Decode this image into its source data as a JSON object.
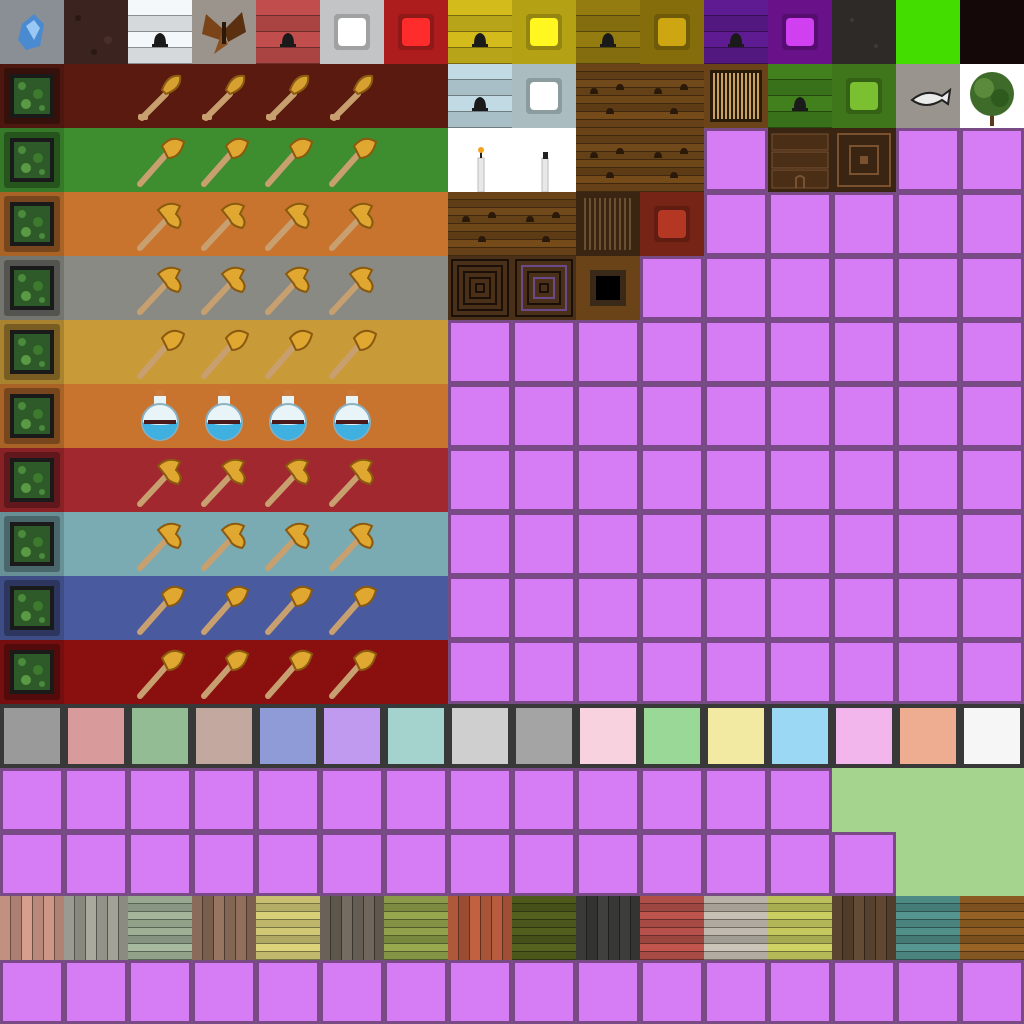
{
  "sheet": {
    "placeholder_color": "#d67cf4",
    "grid_line_color": "#7a4a86",
    "swatch_border": "#383838"
  },
  "top_row": [
    {
      "icon": "blue-gem-icon",
      "bg": "#8a8f95"
    },
    {
      "icon": "dark-dirt-icon",
      "bg": "#3b2420"
    },
    {
      "icon": "white-plank-bell-icon",
      "bg": "#e8ecef"
    },
    {
      "icon": "moth-icon",
      "bg": "#9a948c"
    },
    {
      "icon": "red-plank-bell-icon",
      "bg": "#b84a48"
    },
    {
      "icon": "white-panel-icon",
      "bg": "#e4e6e8"
    },
    {
      "icon": "red-panel-icon",
      "bg": "#cc2222"
    },
    {
      "icon": "yellow-plank-bell-icon",
      "bg": "#c8b21a"
    },
    {
      "icon": "yellow-panel-icon",
      "bg": "#d4be18"
    },
    {
      "icon": "olive-plank-bell-icon",
      "bg": "#8e7610"
    },
    {
      "icon": "olive-panel-icon",
      "bg": "#9e800e"
    },
    {
      "icon": "purple-plank-bell-icon",
      "bg": "#5a1a8a"
    },
    {
      "icon": "magenta-panel-icon",
      "bg": "#7a14a0"
    },
    {
      "icon": "dark-stone-icon",
      "bg": "#2e2a28"
    },
    {
      "icon": "green-block-icon",
      "bg": "#44dd00"
    },
    {
      "icon": "black-block-icon",
      "bg": "#140808"
    }
  ],
  "tool_rows": [
    {
      "color": "#5a1a10",
      "item": "shovel"
    },
    {
      "color": "#3e8e30",
      "item": "axe"
    },
    {
      "color": "#c8742e",
      "item": "hammer"
    },
    {
      "color": "#8a8a84",
      "item": "hammer"
    },
    {
      "color": "#c89a38",
      "item": "axe"
    },
    {
      "color": "#c8742e",
      "item": "potion"
    },
    {
      "color": "#a0282e",
      "item": "hammer"
    },
    {
      "color": "#7aaab2",
      "item": "hammer"
    },
    {
      "color": "#4a5a9e",
      "item": "axe"
    },
    {
      "color": "#8a1010",
      "item": "axe"
    }
  ],
  "furniture_tiles": [
    {
      "icon": "pale-plank-bell-icon",
      "bg": "#b8d0d8"
    },
    {
      "icon": "pale-panel-icon",
      "bg": "#c8dde2"
    },
    {
      "icon": "wood-knobs-icon",
      "bg": "#6a4418"
    },
    {
      "icon": "wood-knobs-icon",
      "bg": "#6a4418"
    },
    {
      "icon": "striped-panel-icon",
      "bg": "#8a6a38"
    },
    {
      "icon": "green-plank-bell-icon",
      "bg": "#3e7a1c"
    },
    {
      "icon": "green-panel-icon",
      "bg": "#4a8a20"
    },
    {
      "icon": "gravel-fish-icon",
      "bg": "#9a948e"
    },
    {
      "icon": "tree-icon",
      "bg": "#ffffff"
    },
    {
      "icon": "candle-lit-icon",
      "bg": "#ffffff"
    },
    {
      "icon": "candle-unlit-icon",
      "bg": "#ffffff"
    },
    {
      "icon": "wood-knobs-icon",
      "bg": "#6a4418"
    },
    {
      "icon": "wood-knobs-icon",
      "bg": "#6a4418"
    },
    {
      "icon": "dresser-icon",
      "bg": "#3a2412"
    },
    {
      "icon": "concentric-panel-icon",
      "bg": "#3a2412"
    },
    {
      "icon": "wood-knobs-icon",
      "bg": "#6a4418"
    },
    {
      "icon": "wood-knobs-icon",
      "bg": "#6a4418"
    },
    {
      "icon": "wood-knobs-icon",
      "bg": "#6a4418"
    },
    {
      "icon": "dark-grill-icon",
      "bg": "#3a2412"
    },
    {
      "icon": "red-panel-icon",
      "bg": "#8a2a1a"
    },
    {
      "icon": "concentric-square-icon",
      "bg": "#4a3018"
    },
    {
      "icon": "concentric-square-purple-icon",
      "bg": "#4a3018"
    },
    {
      "icon": "black-hole-icon",
      "bg": "#6a4418"
    }
  ],
  "swatches": [
    "#9a9a9a",
    "#d99a9c",
    "#93bb94",
    "#c2a89e",
    "#8f9bd6",
    "#c09aee",
    "#a4d2cc",
    "#cfcfcf",
    "#a4a4a4",
    "#f8d2de",
    "#9ad898",
    "#f2eaa2",
    "#9ad8f4",
    "#f2b6ec",
    "#eeac90",
    "#f6f6f6"
  ],
  "wood_textures": [
    {
      "icon": "pink-birch-plank-icon",
      "bg": "#c29080"
    },
    {
      "icon": "gray-plank-icon",
      "bg": "#9a9a90"
    },
    {
      "icon": "sage-slat-icon",
      "bg": "#98a890"
    },
    {
      "icon": "weathered-plank-icon",
      "bg": "#8a6a58"
    },
    {
      "icon": "bamboo-plank-icon",
      "bg": "#c8c070"
    },
    {
      "icon": "dark-gray-plank-icon",
      "bg": "#6a6258"
    },
    {
      "icon": "green-bamboo-icon",
      "bg": "#8a9a48"
    },
    {
      "icon": "red-cedar-plank-icon",
      "bg": "#b0583a"
    },
    {
      "icon": "dark-olive-plank-icon",
      "bg": "#4e5a1c"
    },
    {
      "icon": "charcoal-plank-icon",
      "bg": "#3a3a38"
    },
    {
      "icon": "red-wash-plank-icon",
      "bg": "#b04e48"
    },
    {
      "icon": "pale-gray-plank-icon",
      "bg": "#b8b2a8"
    },
    {
      "icon": "yellow-bamboo-icon",
      "bg": "#bcc05a"
    },
    {
      "icon": "walnut-plank-icon",
      "bg": "#5a4430"
    },
    {
      "icon": "teal-plank-icon",
      "bg": "#4e8a84"
    },
    {
      "icon": "oak-plank-icon",
      "bg": "#8a5a22"
    }
  ],
  "grass_color": "#a4d48e"
}
